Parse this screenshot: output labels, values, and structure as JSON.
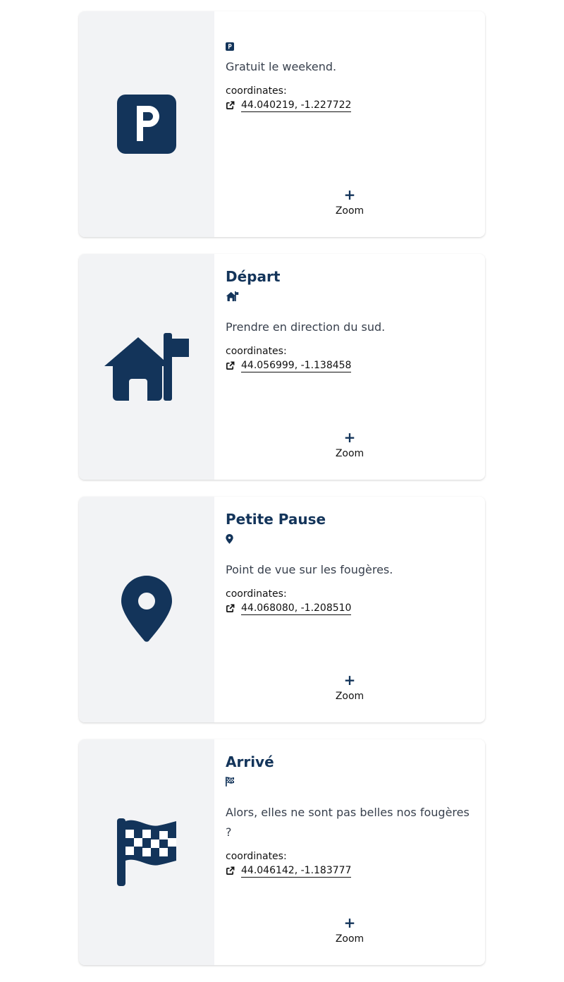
{
  "colors": {
    "accent": "#13345a",
    "panel": "#f2f3f5",
    "text": "#38404d"
  },
  "cards": [
    {
      "icon": "parking-icon",
      "title": "",
      "description": "Gratuit le weekend.",
      "coordinates_label": "coordinates:",
      "coordinates": "44.040219, -1.227722",
      "zoom_symbol": "+",
      "zoom_label": "Zoom"
    },
    {
      "icon": "house-flag-icon",
      "title": "Départ",
      "description": "Prendre en direction du sud.",
      "coordinates_label": "coordinates:",
      "coordinates": "44.056999, -1.138458",
      "zoom_symbol": "+",
      "zoom_label": "Zoom"
    },
    {
      "icon": "location-pin-icon",
      "title": "Petite Pause",
      "description": "Point de vue sur les fougères.",
      "coordinates_label": "coordinates:",
      "coordinates": "44.068080, -1.208510",
      "zoom_symbol": "+",
      "zoom_label": "Zoom"
    },
    {
      "icon": "checkered-flag-icon",
      "title": "Arrivé",
      "description": "Alors, elles ne sont pas belles nos fougères ?",
      "coordinates_label": "coordinates:",
      "coordinates": "44.046142, -1.183777",
      "zoom_symbol": "+",
      "zoom_label": "Zoom"
    }
  ]
}
